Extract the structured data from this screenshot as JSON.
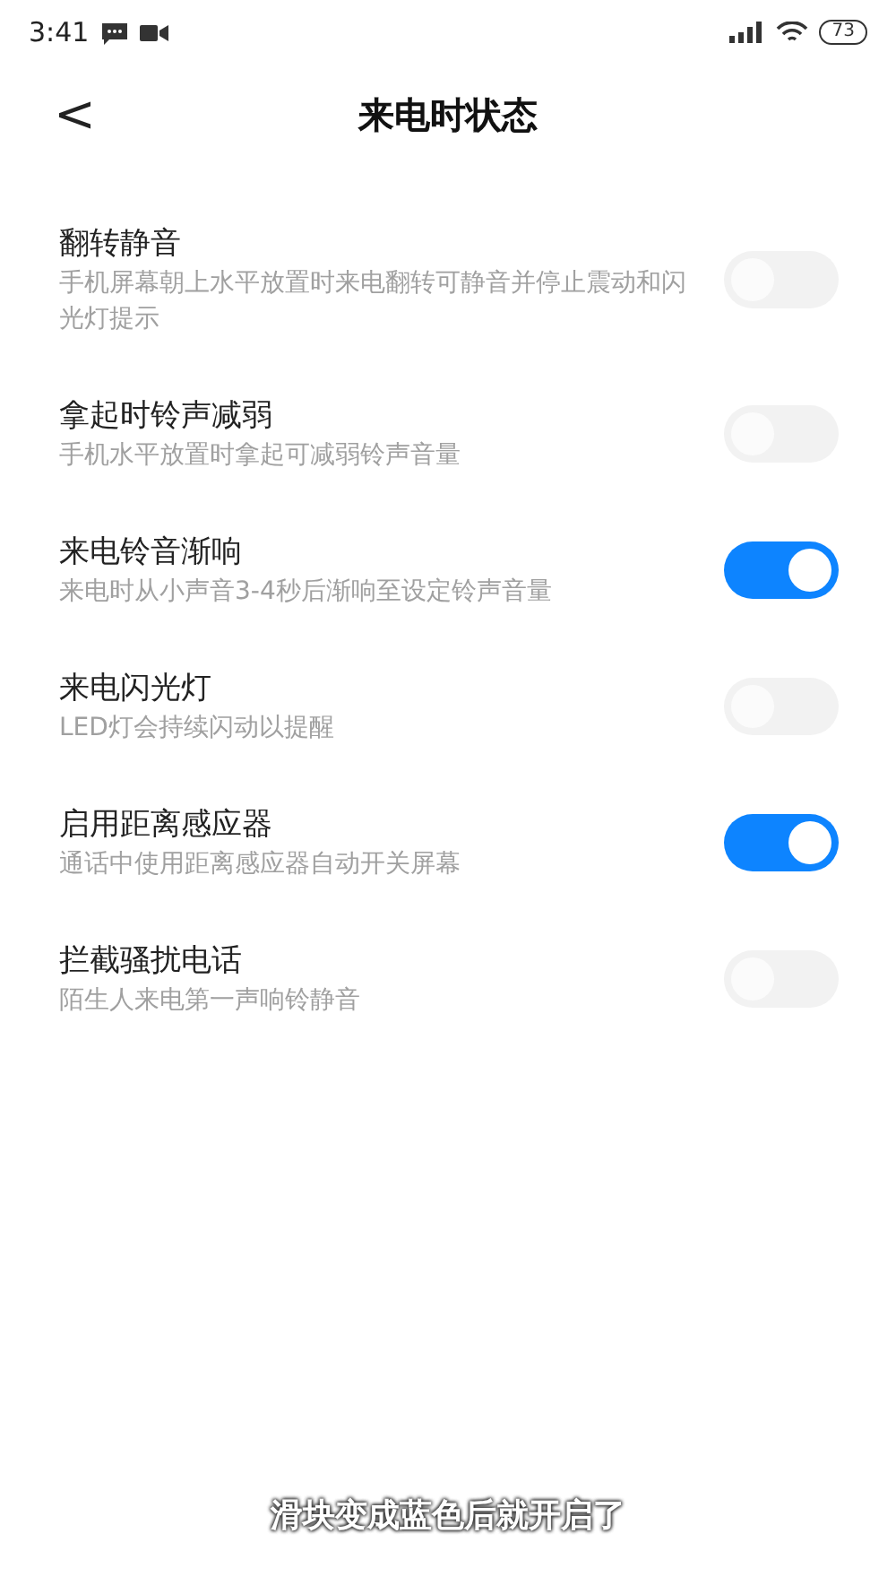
{
  "status_bar": {
    "time": "3:41",
    "battery": "73"
  },
  "header": {
    "back": "<",
    "title": "来电时状态"
  },
  "settings": [
    {
      "title": "翻转静音",
      "subtitle": "手机屏幕朝上水平放置时来电翻转可静音并停止震动和闪光灯提示",
      "on": false
    },
    {
      "title": "拿起时铃声减弱",
      "subtitle": "手机水平放置时拿起可减弱铃声音量",
      "on": false
    },
    {
      "title": "来电铃音渐响",
      "subtitle": "来电时从小声音3-4秒后渐响至设定铃声音量",
      "on": true
    },
    {
      "title": "来电闪光灯",
      "subtitle": "LED灯会持续闪动以提醒",
      "on": false
    },
    {
      "title": "启用距离感应器",
      "subtitle": "通话中使用距离感应器自动开关屏幕",
      "on": true
    },
    {
      "title": "拦截骚扰电话",
      "subtitle": "陌生人来电第一声响铃静音",
      "on": false
    }
  ],
  "caption": "滑块变成蓝色后就开启了"
}
